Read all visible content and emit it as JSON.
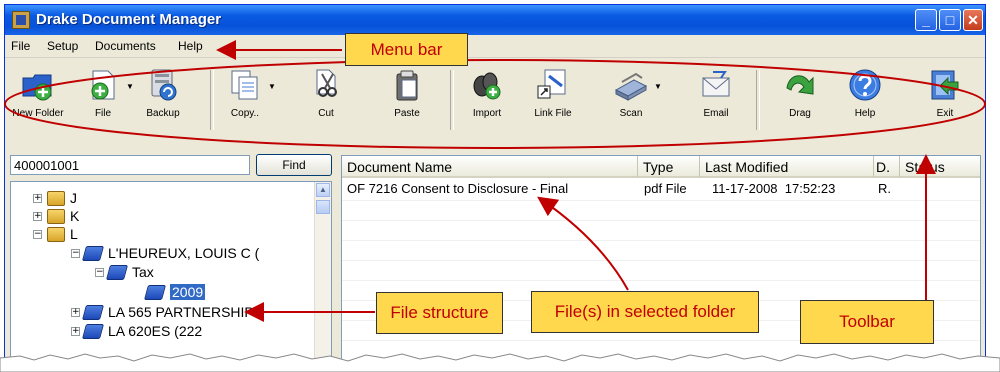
{
  "window": {
    "title": "Drake Document Manager"
  },
  "titlebar_buttons": {
    "minimize": "_",
    "maximize": "□",
    "close": "✕"
  },
  "menu": {
    "items": [
      "File",
      "Setup",
      "Documents",
      "Help"
    ]
  },
  "toolbar": {
    "items": [
      {
        "label": "New Folder",
        "icon": "new-folder-icon"
      },
      {
        "label": "File",
        "icon": "new-file-icon"
      },
      {
        "label": "Backup",
        "icon": "backup-icon"
      },
      {
        "label": "Copy..",
        "icon": "copy-icon"
      },
      {
        "label": "Cut",
        "icon": "cut-icon"
      },
      {
        "label": "Paste",
        "icon": "paste-icon"
      },
      {
        "label": "Import",
        "icon": "import-icon"
      },
      {
        "label": "Link File",
        "icon": "link-file-icon"
      },
      {
        "label": "Scan",
        "icon": "scan-icon"
      },
      {
        "label": "Email",
        "icon": "email-icon"
      },
      {
        "label": "Drag",
        "icon": "drag-icon"
      },
      {
        "label": "Help",
        "icon": "help-icon"
      },
      {
        "label": "Exit",
        "icon": "exit-icon"
      }
    ]
  },
  "search": {
    "value": "400001001",
    "find_label": "Find"
  },
  "tree": {
    "nodes": [
      {
        "label": "J",
        "expander": "+"
      },
      {
        "label": "K",
        "expander": "+"
      },
      {
        "label": "L",
        "expander": "−"
      },
      {
        "label": "L'HEUREUX, LOUIS C (",
        "expander": "−"
      },
      {
        "label": "Tax",
        "expander": "−"
      },
      {
        "label": "2009",
        "expander": ""
      },
      {
        "label": "LA 565 PARTNERSHIP",
        "expander": "+"
      },
      {
        "label": "LA 620ES (222",
        "expander": "+"
      }
    ]
  },
  "file_list": {
    "columns": [
      "Document Name",
      "Type",
      "Last Modified",
      "D.",
      "Status"
    ],
    "rows": [
      {
        "name": "OF 7216 Consent to Disclosure - Final",
        "type": "pdf File",
        "modified": "11-17-2008  17:52:23",
        "d": "R.",
        "status": ""
      }
    ]
  },
  "annotations": {
    "menu_bar": "Menu bar",
    "file_structure": "File structure",
    "files_in_folder": "File(s) in selected folder",
    "toolbar": "Toolbar"
  },
  "colors": {
    "annotation_fill": "#ffd84d",
    "annotation_text": "#c00000",
    "title_blue": "#0a5ae2",
    "selection": "#316ac5"
  }
}
